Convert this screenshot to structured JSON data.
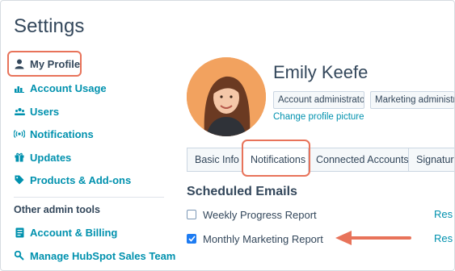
{
  "page": {
    "title": "Settings"
  },
  "sidebar": {
    "items": [
      {
        "label": "My Profile",
        "icon": "user-icon"
      },
      {
        "label": "Account Usage",
        "icon": "bar-chart-icon"
      },
      {
        "label": "Users",
        "icon": "users-icon"
      },
      {
        "label": "Notifications",
        "icon": "broadcast-icon"
      },
      {
        "label": "Updates",
        "icon": "gift-icon"
      },
      {
        "label": "Products & Add-ons",
        "icon": "tag-icon"
      }
    ],
    "other_label": "Other admin tools",
    "other_items": [
      {
        "label": "Account & Billing",
        "icon": "billing-icon"
      },
      {
        "label": "Manage HubSpot Sales Team",
        "icon": "team-icon"
      }
    ]
  },
  "profile": {
    "name": "Emily Keefe",
    "roles": [
      "Account administrator",
      "Marketing administra"
    ],
    "change_picture": "Change profile picture"
  },
  "tabs": [
    "Basic Info",
    "Notifications",
    "Connected Accounts",
    "Signature"
  ],
  "scheduled": {
    "heading": "Scheduled Emails",
    "rows": [
      {
        "label": "Weekly Progress Report",
        "checked": false,
        "link": "Res"
      },
      {
        "label": "Monthly Marketing Report",
        "checked": true,
        "link": "Res"
      }
    ]
  },
  "colors": {
    "accent": "#0091ae",
    "highlight": "#e8735a",
    "checkbox": "#1e7cf2",
    "text": "#33475b"
  }
}
